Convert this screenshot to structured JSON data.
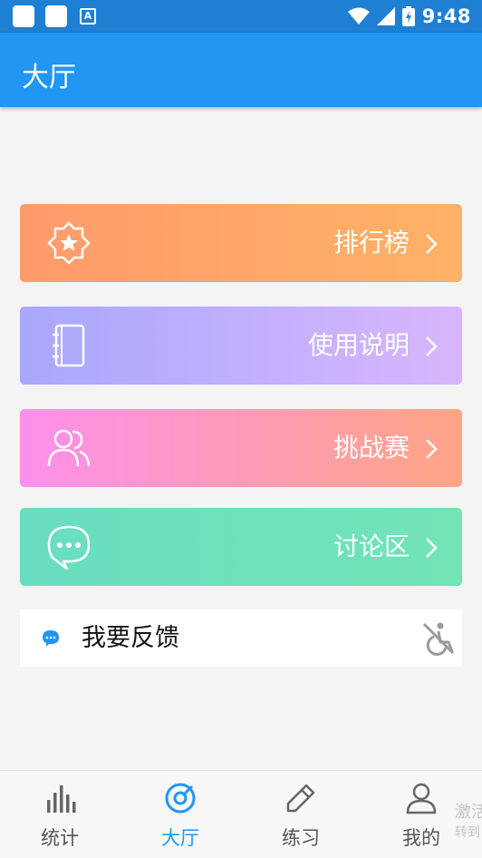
{
  "status_bar": {
    "time": "9:48",
    "app_badge": "A"
  },
  "app_bar": {
    "title": "大厅"
  },
  "menu": [
    {
      "label": "排行榜",
      "icon": "star-badge-icon"
    },
    {
      "label": "使用说明",
      "icon": "notebook-icon"
    },
    {
      "label": "挑战赛",
      "icon": "users-icon"
    },
    {
      "label": "讨论区",
      "icon": "chat-bubble-icon"
    }
  ],
  "feedback": {
    "label": "我要反馈",
    "icon": "chat-dot-icon",
    "accessory_icon": "accessibility-off-icon"
  },
  "bottom_nav": [
    {
      "label": "统计",
      "icon": "bar-chart-icon",
      "active": false
    },
    {
      "label": "大厅",
      "icon": "target-icon",
      "active": true
    },
    {
      "label": "练习",
      "icon": "pencil-icon",
      "active": false
    },
    {
      "label": "我的",
      "icon": "person-icon",
      "active": false
    }
  ],
  "watermark": {
    "line1": "激活",
    "line2": "转到"
  },
  "colors": {
    "primary": "#2196f3",
    "status_bar": "#1f7fd3",
    "nav_active": "#2196f3"
  }
}
